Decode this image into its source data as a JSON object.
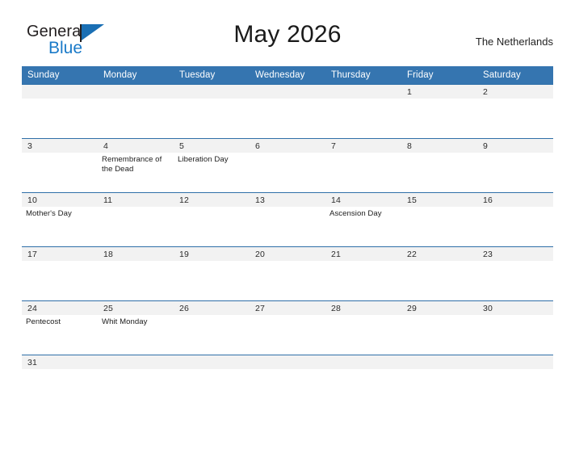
{
  "brand": {
    "name_part1": "General",
    "name_part2": "Blue",
    "color_dark": "#231f20",
    "color_blue": "#1a7ac8"
  },
  "header": {
    "title": "May 2026",
    "region": "The Netherlands"
  },
  "theme": {
    "header_blue": "#3575b0",
    "row_rule_blue": "#2f6fa8",
    "daynum_band": "#f2f2f2",
    "page_background": "#ffffff"
  },
  "calendar": {
    "weekday_headers": [
      "Sunday",
      "Monday",
      "Tuesday",
      "Wednesday",
      "Thursday",
      "Friday",
      "Saturday"
    ],
    "weeks": [
      [
        {
          "day": "",
          "events": []
        },
        {
          "day": "",
          "events": []
        },
        {
          "day": "",
          "events": []
        },
        {
          "day": "",
          "events": []
        },
        {
          "day": "",
          "events": []
        },
        {
          "day": "1",
          "events": []
        },
        {
          "day": "2",
          "events": []
        }
      ],
      [
        {
          "day": "3",
          "events": []
        },
        {
          "day": "4",
          "events": [
            "Remembrance of the Dead"
          ]
        },
        {
          "day": "5",
          "events": [
            "Liberation Day"
          ]
        },
        {
          "day": "6",
          "events": []
        },
        {
          "day": "7",
          "events": []
        },
        {
          "day": "8",
          "events": []
        },
        {
          "day": "9",
          "events": []
        }
      ],
      [
        {
          "day": "10",
          "events": [
            "Mother's Day"
          ]
        },
        {
          "day": "11",
          "events": []
        },
        {
          "day": "12",
          "events": []
        },
        {
          "day": "13",
          "events": []
        },
        {
          "day": "14",
          "events": [
            "Ascension Day"
          ]
        },
        {
          "day": "15",
          "events": []
        },
        {
          "day": "16",
          "events": []
        }
      ],
      [
        {
          "day": "17",
          "events": []
        },
        {
          "day": "18",
          "events": []
        },
        {
          "day": "19",
          "events": []
        },
        {
          "day": "20",
          "events": []
        },
        {
          "day": "21",
          "events": []
        },
        {
          "day": "22",
          "events": []
        },
        {
          "day": "23",
          "events": []
        }
      ],
      [
        {
          "day": "24",
          "events": [
            "Pentecost"
          ]
        },
        {
          "day": "25",
          "events": [
            "Whit Monday"
          ]
        },
        {
          "day": "26",
          "events": []
        },
        {
          "day": "27",
          "events": []
        },
        {
          "day": "28",
          "events": []
        },
        {
          "day": "29",
          "events": []
        },
        {
          "day": "30",
          "events": []
        }
      ],
      [
        {
          "day": "31",
          "events": []
        },
        {
          "day": "",
          "events": []
        },
        {
          "day": "",
          "events": []
        },
        {
          "day": "",
          "events": []
        },
        {
          "day": "",
          "events": []
        },
        {
          "day": "",
          "events": []
        },
        {
          "day": "",
          "events": []
        }
      ]
    ]
  }
}
